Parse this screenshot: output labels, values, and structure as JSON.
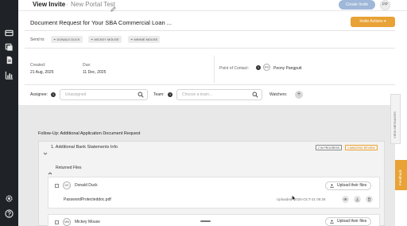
{
  "header": {
    "title": "View Invite",
    "separator": "·",
    "subtitle": "New Portal Test",
    "create_invite_label": "Create Invite",
    "user_initials": "PP"
  },
  "document": {
    "title": "Document Request for Your SBA Commercial Loan ...",
    "invite_actions_label": "Invite Actions ▾",
    "send_to_label": "Send to:",
    "recipients": [
      "DONALD DUCK",
      "MICKEY MOUSE",
      "MINNIE MOUSE"
    ]
  },
  "meta": {
    "created_label": "Created:",
    "created_value": "21 Aug, 2025",
    "due_label": "Due:",
    "due_value": "11 Dec, 2025",
    "poc_label": "Point of Contact:",
    "poc_initials": "PP",
    "poc_name": "Peony Pangputt"
  },
  "filters": {
    "assignee_label": "Assignee:",
    "assignee_placeholder": "Unassigned",
    "team_label": "Team:",
    "team_placeholder": "Choose a team...",
    "watchers_label": "Watchers:"
  },
  "side_tabs": {
    "view_messages": "VIEW MESSAGES",
    "feedback": "Feedback"
  },
  "followup": {
    "title": "Follow-Up: Additional Application Document Request",
    "section_title": "1. Additional Bank Statements Info",
    "badge_in_progress": "2 IN PROGRESS",
    "badge_awaiting": "1 AWAITING REVIEW",
    "returned_files_label": "Returned Files",
    "rows": [
      {
        "initials": "DD",
        "name": "Donald Duck",
        "upload_label": "Upload their files",
        "filename": "PasswordProtecteddoc.pdf",
        "uploaded": "Uploaded: 2025-OCT-31 09:28"
      },
      {
        "initials": "MM",
        "name": "Mickey Mouse",
        "upload_label": "Upload their files"
      }
    ]
  },
  "colors": {
    "sidebar": "#1f2327",
    "accent_orange": "#e8a235",
    "create_button": "#9fb7d8",
    "content_bg": "#e8e8e8"
  }
}
